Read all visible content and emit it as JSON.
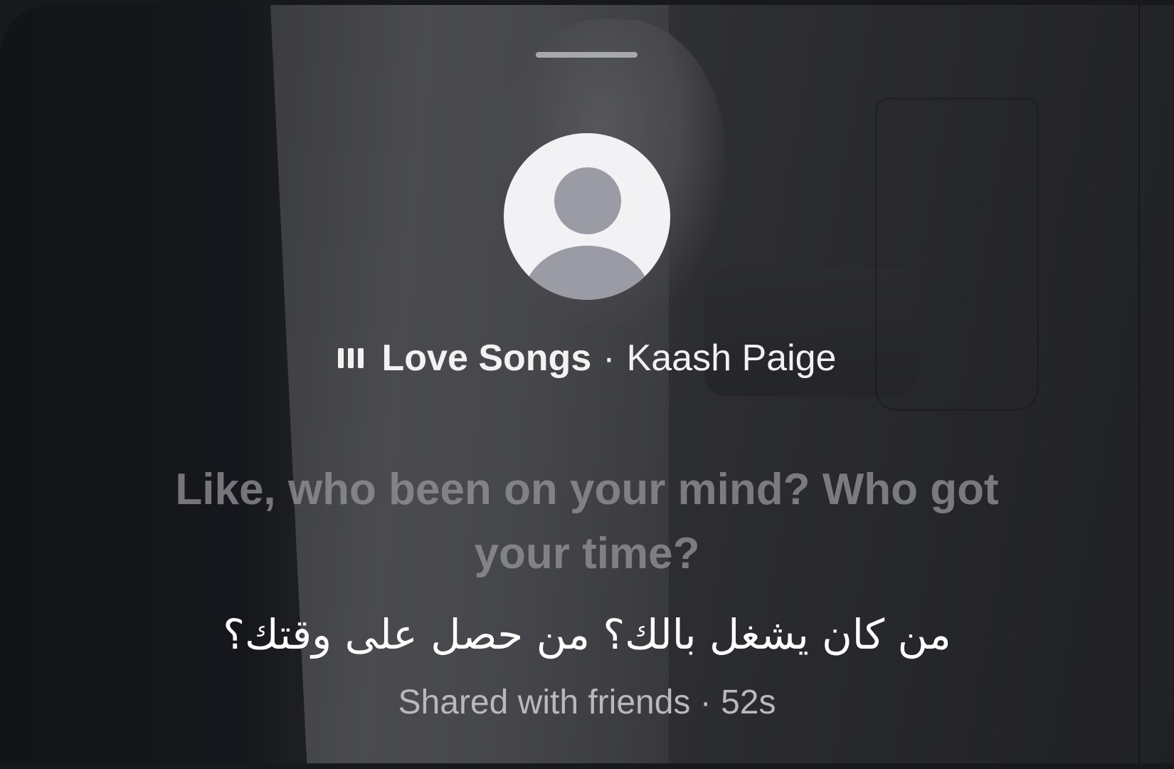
{
  "song": {
    "title": "Love Songs",
    "separator": "·",
    "artist": "Kaash Paige",
    "playing_icon": "equalizer-bars-icon"
  },
  "lyrics": {
    "line_en": "Like, who been on your mind? Who got your time?",
    "line_ar": "من كان يشغل بالك؟ من حصل على وقتك؟"
  },
  "footer": {
    "text": "Shared with friends · 52s"
  },
  "avatar": {
    "icon": "default-profile-avatar"
  },
  "colors": {
    "primary_text": "#f2f2f2",
    "muted_text": "#b9b9bd",
    "avatar_bg": "#f2f2f4",
    "avatar_glyph": "#9a9ba4"
  }
}
